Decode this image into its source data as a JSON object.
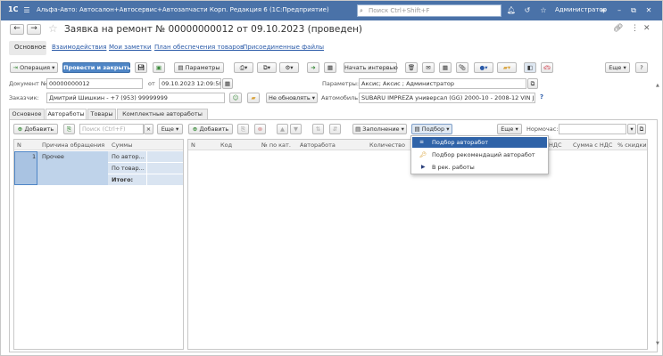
{
  "app": {
    "title": "Альфа-Авто: Автосалон+Автосервис+Автозапчасти Корп. Редакция 6  (1С:Предприятие)",
    "logo": "1С",
    "search_placeholder": "Поиск Ctrl+Shift+F",
    "user": "Администратор"
  },
  "document": {
    "title": "Заявка на ремонт № 00000000012 от 09.10.2023 (проведен)"
  },
  "nav_tabs": [
    "Основное",
    "Взаимодействия",
    "Мои заметки",
    "План обеспечения товаров",
    "Присоединенные файлы"
  ],
  "toolbar": {
    "operation": "Операция",
    "post_close": "Провести и закрыть",
    "parameters": "Параметры",
    "start_interview": "Начать интервью",
    "more": "Еще",
    "help": "?"
  },
  "fields": {
    "doc_no_label": "Документ №:",
    "doc_no": "00000000012",
    "date_label": "от",
    "date": "09.10.2023 12:09:50",
    "params_label": "Параметры:",
    "params": "Аксис; Аксис ; Администратор",
    "customer_label": "Заказчик:",
    "customer": "Дмитрий Шишкин - +7 (953) 99999999",
    "no_update": "Не обновлять",
    "auto_label": "Автомобиль:",
    "auto": "SUBARU IMPREZA универсал (GG) 2000-10 - 2008-12 VIN JF1GG:"
  },
  "inner_tabs": [
    "Основное",
    "Автоработы",
    "Товары",
    "Комплектные автоработы"
  ],
  "left_panel": {
    "add": "Добавить",
    "search_placeholder": "Поиск (Ctrl+F)",
    "more": "Еще",
    "columns": [
      "N",
      "Причина обращения",
      "Суммы"
    ],
    "row": {
      "n": "1",
      "reason": "Прочее",
      "sum1": "По автор...",
      "sum2": "По товар...",
      "total": "Итого:"
    }
  },
  "right_panel": {
    "add": "Добавить",
    "fill": "Заполнение",
    "select": "Подбор",
    "more": "Еще",
    "norm_label": "Нормочас:",
    "columns": [
      "N",
      "Код",
      "№ по кат.",
      "Авторабота",
      "Количество",
      "НДС",
      "Сумма с НДС",
      "% скидки"
    ]
  },
  "dropdown": {
    "items": [
      "Подбор авторабот",
      "Подбор рекомендаций авторабот",
      "В рек. работы"
    ]
  },
  "colors": {
    "titlebar": "#4a72a8",
    "accent": "#4f86c6",
    "selection": "#2f63a8"
  }
}
